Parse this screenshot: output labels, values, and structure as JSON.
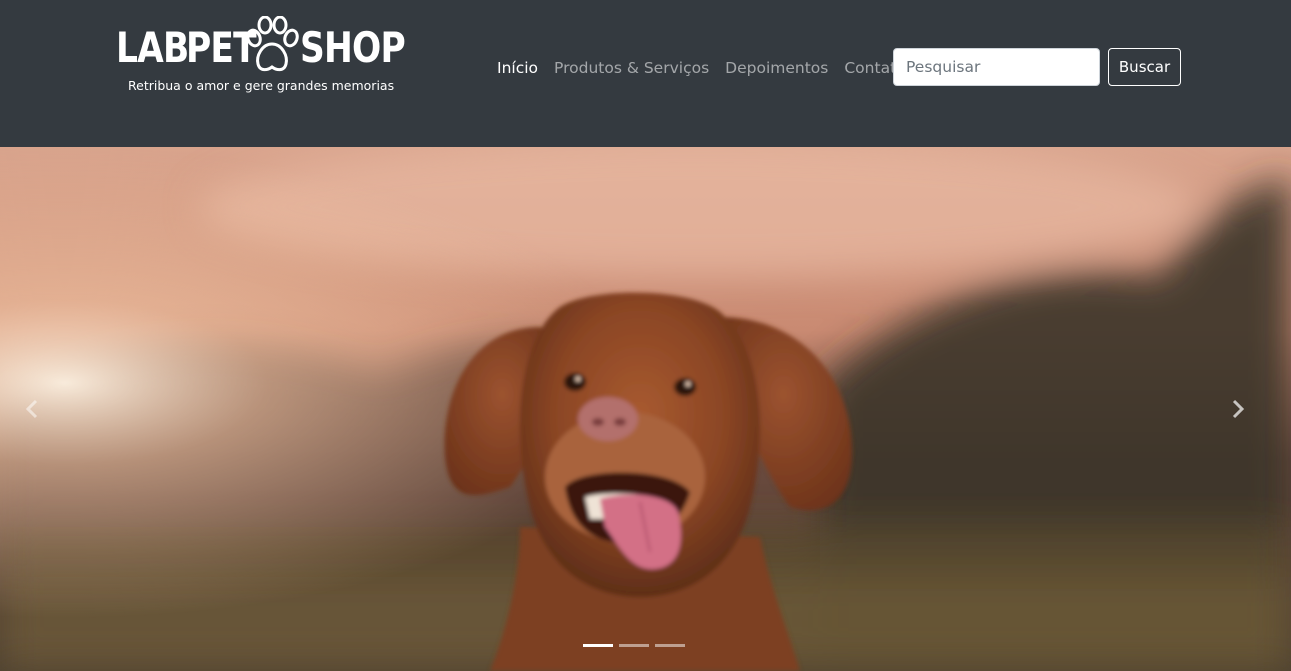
{
  "brand": {
    "logo_parts": [
      "LAB",
      "PET",
      "SHOP"
    ],
    "tagline": "Retribua o amor e gere grandes memorias",
    "logo_icon": "paw-icon"
  },
  "nav": {
    "items": [
      {
        "label": "Início",
        "active": true
      },
      {
        "label": "Produtos & Serviços",
        "active": false
      },
      {
        "label": "Depoimentos",
        "active": false
      },
      {
        "label": "Contato",
        "active": false
      }
    ]
  },
  "search": {
    "placeholder": "Pesquisar",
    "value": "",
    "button_label": "Buscar"
  },
  "carousel": {
    "active_index": 0,
    "slide_count": 3,
    "prev_icon": "chevron-left-icon",
    "next_icon": "chevron-right-icon"
  },
  "colors": {
    "navbar_bg": "#343a40",
    "nav_active": "#ffffff",
    "nav_inactive": "rgba(255,255,255,0.55)"
  }
}
